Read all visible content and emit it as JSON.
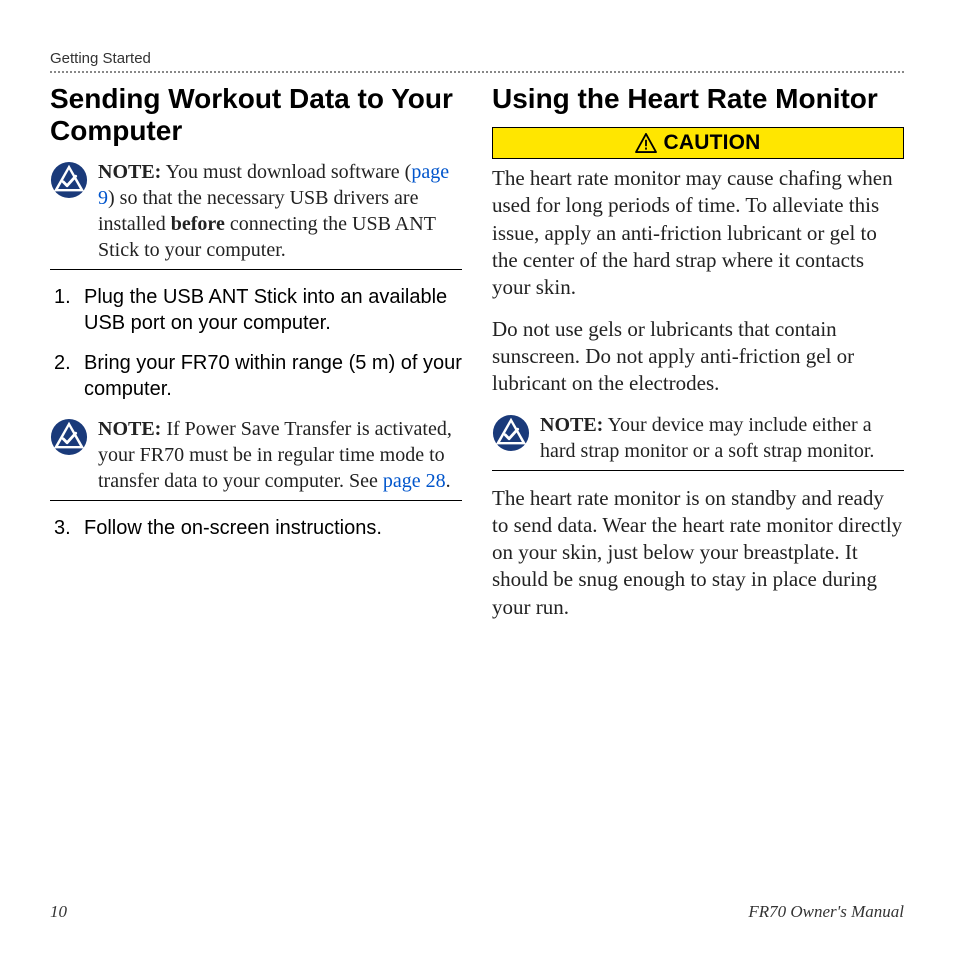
{
  "header": {
    "section": "Getting Started"
  },
  "left": {
    "heading": "Sending Workout Data to Your Computer",
    "note1": {
      "prefix": "NOTE:",
      "t1": " You must download software (",
      "link": "page 9",
      "t2": ") so that the necessary USB drivers are installed ",
      "bold": "before",
      "t3": " connecting the USB ANT Stick to your computer."
    },
    "steps": {
      "s1": "Plug the USB ANT Stick into an available USB port on your computer.",
      "s2": "Bring your FR70 within range (5 m) of your computer.",
      "s3": "Follow the on-screen instructions."
    },
    "note2": {
      "prefix": "NOTE:",
      "t1": " If Power Save Transfer is activated, your FR70 must be in regular time mode to transfer data to your computer. See ",
      "link": "page 28",
      "t2": "."
    }
  },
  "right": {
    "heading": "Using the Heart Rate Monitor",
    "caution_label": "CAUTION",
    "caution_text": "The heart rate monitor may cause chafing when used for long periods of time. To alleviate this issue, apply an anti-friction lubricant or gel to the center of the hard strap where it contacts your skin.",
    "para2": "Do not use gels or lubricants that contain sunscreen. Do not apply anti-friction gel or lubricant on the electrodes.",
    "note": {
      "prefix": "NOTE:",
      "text": " Your device may include either a hard strap monitor or a soft strap monitor."
    },
    "para3": "The heart rate monitor is on standby and ready to send data. Wear the heart rate monitor directly on your skin, just below your breastplate. It should be snug enough to stay in place during your run."
  },
  "footer": {
    "page": "10",
    "title": "FR70 Owner's Manual"
  }
}
